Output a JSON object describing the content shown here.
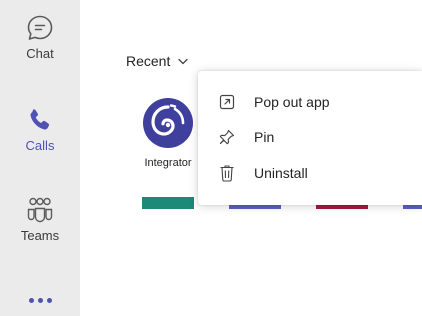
{
  "rail": {
    "items": [
      {
        "label": "Chat",
        "icon": "chat-icon",
        "active": false
      },
      {
        "label": "Calls",
        "icon": "phone-icon",
        "active": true
      },
      {
        "label": "Teams",
        "icon": "teams-icon",
        "active": false
      }
    ],
    "more_icon": "more-icon"
  },
  "main": {
    "recent_label": "Recent",
    "app_tile": {
      "name": "Integrator",
      "icon": "integrator-logo-icon"
    },
    "color_bars": [
      "#1b8a78",
      "#5b5fc7",
      "#a31b3a",
      "#5b5fc7"
    ]
  },
  "context_menu": {
    "items": [
      {
        "label": "Pop out app",
        "icon": "pop-out-icon"
      },
      {
        "label": "Pin",
        "icon": "pin-icon"
      },
      {
        "label": "Uninstall",
        "icon": "trash-icon"
      }
    ]
  },
  "colors": {
    "rail_bg": "#ebebeb",
    "accent": "#4f52b2",
    "text": "#252423"
  }
}
